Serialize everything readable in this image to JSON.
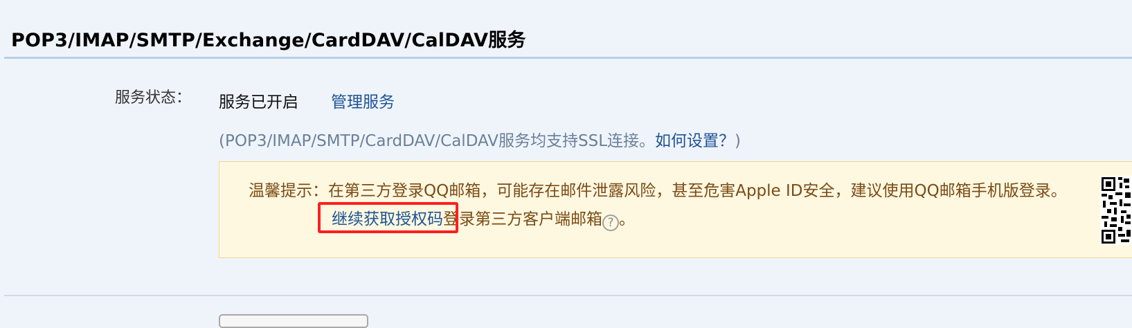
{
  "section": {
    "title": "POP3/IMAP/SMTP/Exchange/CardDAV/CalDAV服务"
  },
  "service": {
    "label": "服务状态：",
    "status": "服务已开启",
    "manage_link": "管理服务"
  },
  "ssl_note": {
    "prefix": "(POP3/IMAP/SMTP/CardDAV/CalDAV服务均支持SSL连接。",
    "howto_link": "如何设置？",
    "suffix": ")"
  },
  "tip": {
    "line1": "温馨提示：在第三方登录QQ邮箱，可能存在邮件泄露风险，甚至危害Apple ID安全，建议使用QQ邮箱手机版登录。",
    "auth_link": "继续获取授权码",
    "line2_rest": "登录第三方客户端邮箱",
    "help_icon_glyph": "?",
    "line2_end": "。"
  },
  "icons": {
    "help": "help-icon",
    "qr": "qr-code-icon"
  },
  "colors": {
    "link": "#1e5494",
    "tip_text": "#7a4b14",
    "tip_background": "#fff8e1",
    "highlight": "#ff1f1f"
  }
}
